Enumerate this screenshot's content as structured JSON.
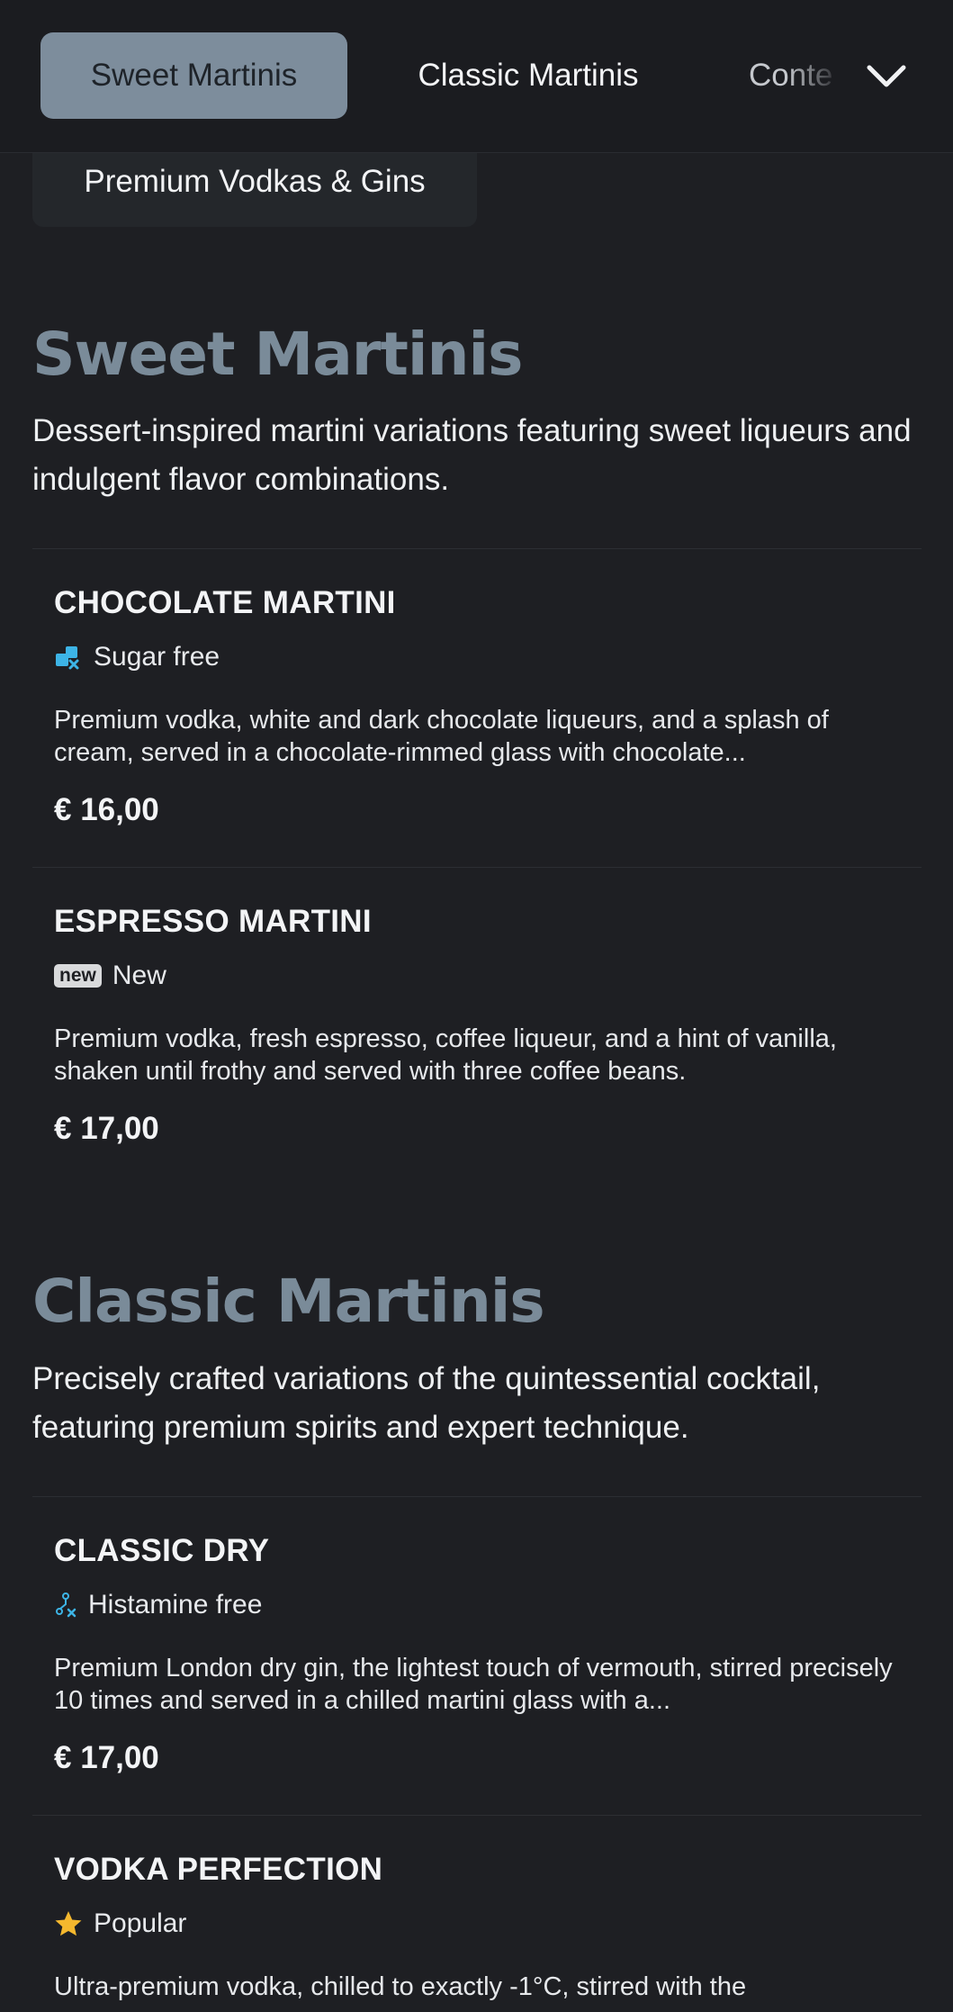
{
  "nav": {
    "tabs": [
      {
        "label": "Sweet Martinis"
      },
      {
        "label": "Classic Martinis"
      },
      {
        "label": "Conte"
      }
    ],
    "second_row": {
      "label": "Premium Vodkas & Gins"
    }
  },
  "sections": [
    {
      "title": "Sweet Martinis",
      "description": "Dessert-inspired martini variations featuring sweet liqueurs and indulgent flavor combinations.",
      "items": [
        {
          "name": "CHOCOLATE MARTINI",
          "tag": "Sugar free",
          "tag_icon": "sugar-free-icon",
          "description": "Premium vodka, white and dark chocolate liqueurs, and a splash of cream, served in a chocolate-rimmed glass with chocolate...",
          "price": "€ 16,00"
        },
        {
          "name": "ESPRESSO MARTINI",
          "badge": "new",
          "tag": "New",
          "description": "Premium vodka, fresh espresso, coffee liqueur, and a hint of vanilla, shaken until frothy and served with three coffee beans.",
          "price": "€ 17,00"
        }
      ]
    },
    {
      "title": "Classic Martinis",
      "description": "Precisely crafted variations of the quintessential cocktail, featuring premium spirits and expert technique.",
      "items": [
        {
          "name": "CLASSIC DRY",
          "tag": "Histamine free",
          "tag_icon": "histamine-free-icon",
          "description": "Premium London dry gin, the lightest touch of vermouth, stirred precisely 10 times and served in a chilled martini glass with a...",
          "price": "€ 17,00"
        },
        {
          "name": "VODKA PERFECTION",
          "tag": "Popular",
          "tag_icon": "star-icon",
          "description": "Ultra-premium vodka, chilled to exactly -1°C, stirred with the"
        }
      ]
    }
  ],
  "colors": {
    "background": "#1e1f23",
    "accent": "#7a8b99",
    "active_tab": "#7d8d9c",
    "icon_blue": "#3db4e6",
    "star": "#f5b82e"
  }
}
